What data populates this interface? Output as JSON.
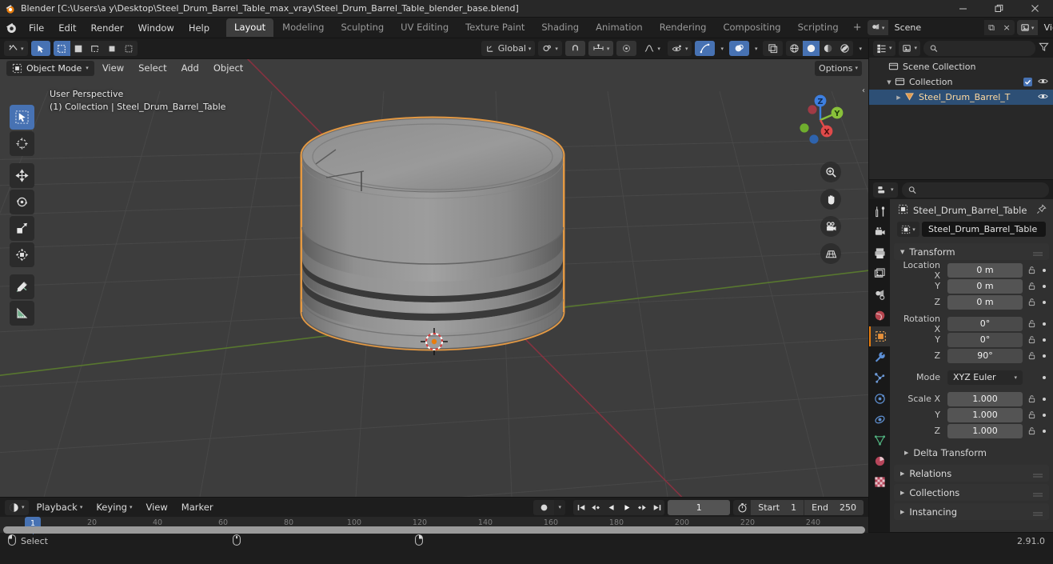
{
  "window": {
    "title": "Blender [C:\\Users\\a y\\Desktop\\Steel_Drum_Barrel_Table_max_vray\\Steel_Drum_Barrel_Table_blender_base.blend]",
    "minimize": "–",
    "maximize": "❐",
    "close": "×"
  },
  "topbar": {
    "menus": [
      "File",
      "Edit",
      "Render",
      "Window",
      "Help"
    ],
    "workspaces": [
      {
        "label": "Layout",
        "active": true
      },
      {
        "label": "Modeling",
        "active": false
      },
      {
        "label": "Sculpting",
        "active": false
      },
      {
        "label": "UV Editing",
        "active": false
      },
      {
        "label": "Texture Paint",
        "active": false
      },
      {
        "label": "Shading",
        "active": false
      },
      {
        "label": "Animation",
        "active": false
      },
      {
        "label": "Rendering",
        "active": false
      },
      {
        "label": "Compositing",
        "active": false
      },
      {
        "label": "Scripting",
        "active": false
      }
    ],
    "add_workspace": "+",
    "scene_name": "Scene",
    "view_layer_name": "View Layer",
    "new_copy_label": "⧉",
    "unlink_label": "×"
  },
  "viewport_header": {
    "editor_type_icon": "editor-type-icon",
    "select_mode_icon": "select-box-icon",
    "snap_modes": [
      "tweak",
      "box",
      "circle",
      "lasso",
      "all"
    ],
    "transform_orientation": "Global",
    "pivot_icon": "pivot-icon",
    "snap_icon": "magnet-icon",
    "snap_to_icon": "snap-increment-icon",
    "proportional_icon": "proportional-edit-icon",
    "falloff_icon": "falloff-curve-icon",
    "options_label": "Options",
    "visibility_icon": "visibility-icon",
    "gizmo_icon": "gizmo-icon",
    "overlays_icon": "overlays-icon",
    "xray_icon": "xray-toggle-icon",
    "shading_modes": [
      "wireframe",
      "solid",
      "material-preview",
      "rendered"
    ],
    "shading_active": "solid"
  },
  "viewport_header2": {
    "mode": "Object Mode",
    "menus": [
      "View",
      "Select",
      "Add",
      "Object"
    ]
  },
  "viewport": {
    "overlay_line1": "User Perspective",
    "overlay_line2": "(1) Collection | Steel_Drum_Barrel_Table",
    "tools": [
      {
        "name": "tweak-select-tool",
        "active": true
      },
      {
        "name": "cursor-tool",
        "active": false
      },
      {
        "name": "move-tool",
        "active": false
      },
      {
        "name": "rotate-tool",
        "active": false
      },
      {
        "name": "scale-tool",
        "active": false
      },
      {
        "name": "transform-tool",
        "active": false
      },
      {
        "name": "annotate-tool",
        "active": false
      },
      {
        "name": "measure-tool",
        "active": false
      }
    ],
    "gizmo_axes": [
      {
        "label": "Z",
        "color": "#3d7fe0"
      },
      {
        "label": "Y",
        "color": "#89c13a"
      },
      {
        "label": "X",
        "color": "#e04a4a"
      }
    ],
    "nav_buttons": [
      "zoom-icon",
      "pan-hand-icon",
      "camera-icon",
      "perspective-grid-icon"
    ],
    "selection_outline_color": "#ed9e43",
    "object_color": "#8a8a8a",
    "background_color": "#3d3d3d"
  },
  "timeline": {
    "editor_icon": "timeline-editor-icon",
    "menus": [
      "Playback",
      "Keying",
      "View",
      "Marker"
    ],
    "record_icon": "auto-keying-icon",
    "transport": [
      "jump-start-icon",
      "prev-keyframe-icon",
      "play-reverse-icon",
      "play-icon",
      "next-keyframe-icon",
      "jump-end-icon"
    ],
    "current_frame": "1",
    "timer_icon": "stopwatch-icon",
    "start_label": "Start",
    "start_value": "1",
    "end_label": "End",
    "end_value": "250",
    "ruler_ticks": [
      "20",
      "40",
      "60",
      "80",
      "100",
      "120",
      "140",
      "160",
      "180",
      "200",
      "220",
      "240"
    ],
    "playhead_frame": "1"
  },
  "outliner": {
    "display_mode_icon": "outliner-display-mode-icon",
    "filter_icon": "filter-icon",
    "search_placeholder": "",
    "rows": [
      {
        "label": "Scene Collection",
        "indent": 0,
        "icon": "collection-icon",
        "triangle": "",
        "selected": false,
        "has_checkbox": false,
        "has_eye": false
      },
      {
        "label": "Collection",
        "indent": 1,
        "icon": "collection-icon",
        "triangle": "▼",
        "selected": false,
        "has_checkbox": true,
        "has_eye": true
      },
      {
        "label": "Steel_Drum_Barrel_T",
        "indent": 2,
        "icon": "mesh-object-icon",
        "triangle": "▶",
        "selected": true,
        "has_checkbox": false,
        "has_eye": true
      }
    ]
  },
  "properties": {
    "editor_icon": "properties-editor-icon",
    "search_placeholder": "",
    "tabs": [
      {
        "name": "tool",
        "active": false
      },
      {
        "name": "render",
        "active": false
      },
      {
        "name": "output",
        "active": false
      },
      {
        "name": "view-layer",
        "active": false
      },
      {
        "name": "scene",
        "active": false
      },
      {
        "name": "world",
        "active": false
      },
      {
        "name": "object",
        "active": true
      },
      {
        "name": "modifiers",
        "active": false
      },
      {
        "name": "particles",
        "active": false
      },
      {
        "name": "physics",
        "active": false
      },
      {
        "name": "constraints",
        "active": false
      },
      {
        "name": "object-data",
        "active": false
      },
      {
        "name": "material",
        "active": false
      },
      {
        "name": "texture",
        "active": false
      }
    ],
    "breadcrumb_object": "Steel_Drum_Barrel_Table",
    "pin_icon": "pin-icon",
    "name_field_value": "Steel_Drum_Barrel_Table",
    "transform_panel": "Transform",
    "fields": [
      {
        "label": "Location X",
        "value": "0 m"
      },
      {
        "label": "Y",
        "value": "0 m"
      },
      {
        "label": "Z",
        "value": "0 m"
      },
      {
        "label": "Rotation X",
        "value": "0°",
        "dim": true
      },
      {
        "label": "Y",
        "value": "0°",
        "dim": true
      },
      {
        "label": "Z",
        "value": "90°",
        "dim": true
      }
    ],
    "mode_label": "Mode",
    "mode_value": "XYZ Euler",
    "scale_fields": [
      {
        "label": "Scale X",
        "value": "1.000"
      },
      {
        "label": "Y",
        "value": "1.000"
      },
      {
        "label": "Z",
        "value": "1.000"
      }
    ],
    "delta_transform": "Delta Transform",
    "panels": [
      "Relations",
      "Collections",
      "Instancing"
    ]
  },
  "statusbar": {
    "select_label": "Select",
    "version": "2.91.0"
  }
}
